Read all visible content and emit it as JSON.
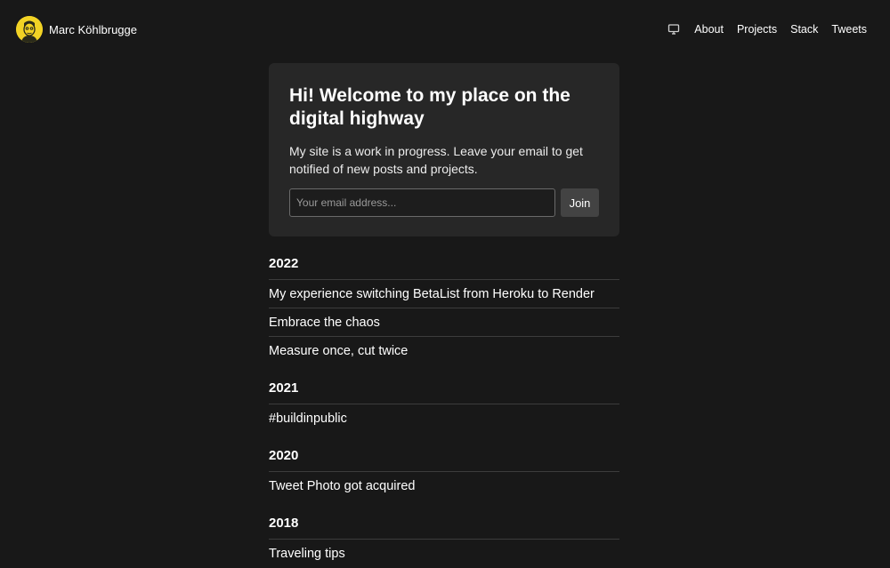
{
  "header": {
    "brand_name": "Marc Köhlbrugge",
    "theme_icon": "monitor-icon",
    "nav": [
      {
        "label": "About"
      },
      {
        "label": "Projects"
      },
      {
        "label": "Stack"
      },
      {
        "label": "Tweets"
      }
    ]
  },
  "signup": {
    "title": "Hi! Welcome to my place on the digital highway",
    "text": "My site is a work in progress. Leave your email to get notified of new posts and projects.",
    "email_placeholder": "Your email address...",
    "join_label": "Join"
  },
  "posts": [
    {
      "year": "2022",
      "items": [
        {
          "title": "My experience switching BetaList from Heroku to Render"
        },
        {
          "title": "Embrace the chaos"
        },
        {
          "title": "Measure once, cut twice"
        }
      ]
    },
    {
      "year": "2021",
      "items": [
        {
          "title": "#buildinpublic"
        }
      ]
    },
    {
      "year": "2020",
      "items": [
        {
          "title": "Tweet Photo got acquired"
        }
      ]
    },
    {
      "year": "2018",
      "items": [
        {
          "title": "Traveling tips"
        }
      ]
    }
  ],
  "colors": {
    "background": "#181818",
    "card": "#272727",
    "avatar": "#f2d325",
    "button": "#434343"
  }
}
